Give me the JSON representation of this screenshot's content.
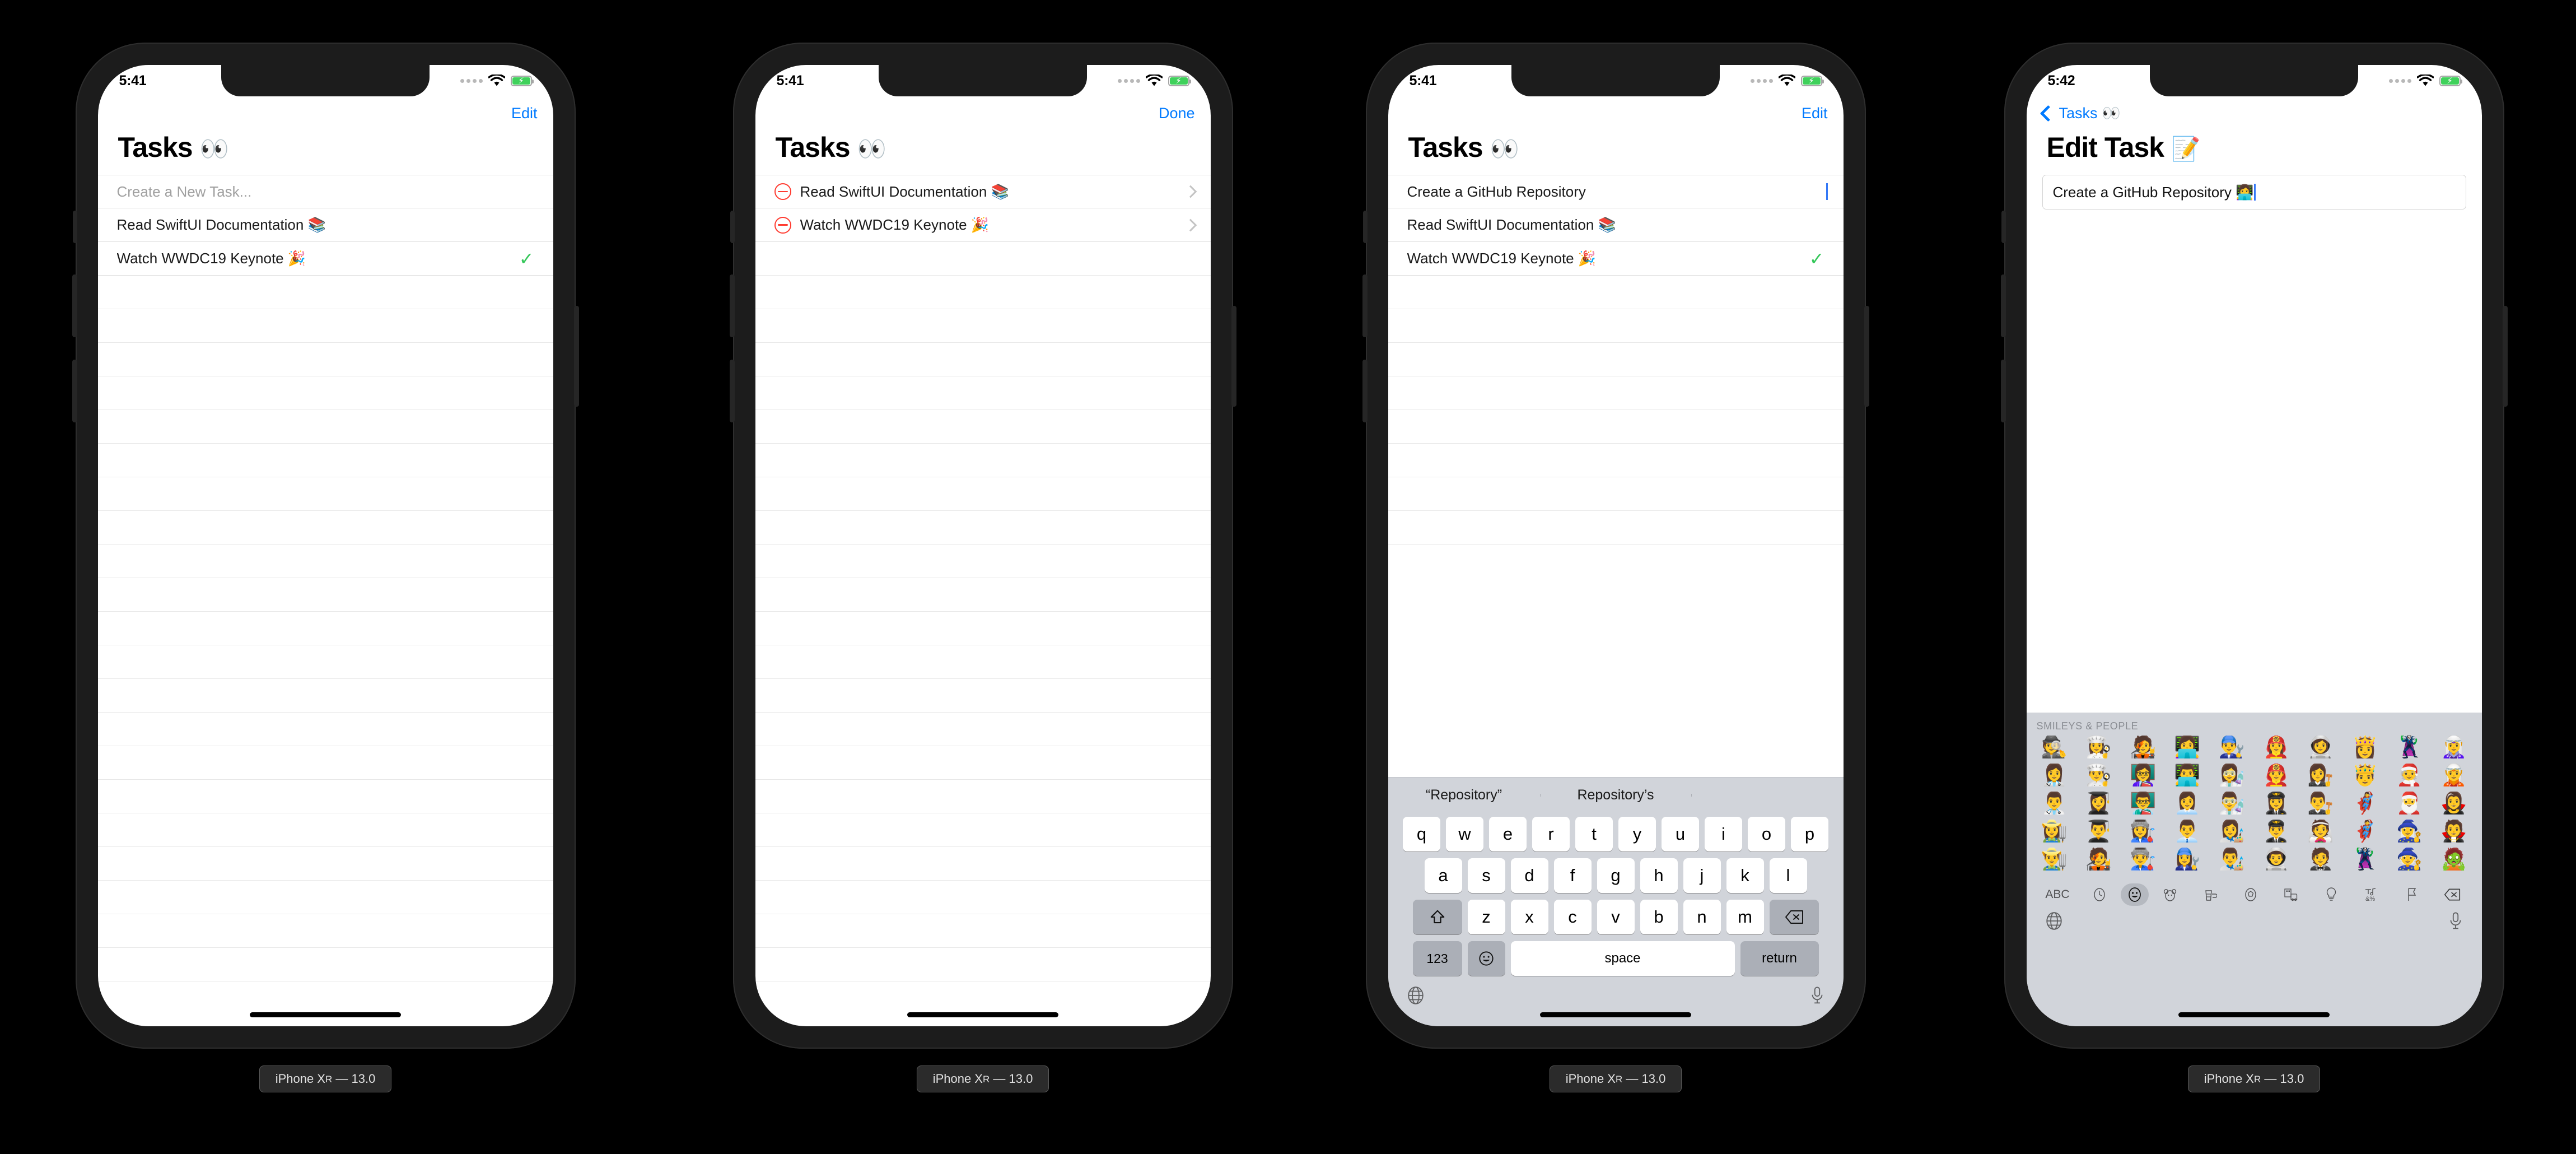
{
  "background_color": "#000000",
  "accent_color": "#007aff",
  "destructive_color": "#ff3b30",
  "success_color": "#34c759",
  "devices": [
    {
      "caption_prefix": "iPhone X",
      "caption_sub": "R",
      "caption_suffix": " — 13.0",
      "status_bar": {
        "time": "5:41",
        "wifi": "wifi-icon",
        "battery": "battery-charging-icon"
      },
      "nav": {
        "action_label": "Edit"
      },
      "title": {
        "text": "Tasks",
        "emoji": "👀"
      },
      "rows": [
        {
          "type": "input",
          "placeholder": "Create a New Task...",
          "value": "",
          "done": false
        },
        {
          "type": "task",
          "label": "Read SwiftUI Documentation 📚",
          "done": false
        },
        {
          "type": "task",
          "label": "Watch WWDC19 Keynote 🎉",
          "done": true
        }
      ],
      "empty_row_count": 22,
      "keyboard": "none"
    },
    {
      "caption_prefix": "iPhone X",
      "caption_sub": "R",
      "caption_suffix": " — 13.0",
      "status_bar": {
        "time": "5:41",
        "wifi": "wifi-icon",
        "battery": "battery-charging-icon"
      },
      "nav": {
        "action_label": "Done"
      },
      "title": {
        "text": "Tasks",
        "emoji": "👀"
      },
      "rows": [
        {
          "type": "task-editing",
          "label": "Read SwiftUI Documentation 📚",
          "done": false
        },
        {
          "type": "task-editing",
          "label": "Watch WWDC19 Keynote 🎉",
          "done": false
        }
      ],
      "empty_row_count": 23,
      "keyboard": "none"
    },
    {
      "caption_prefix": "iPhone X",
      "caption_sub": "R",
      "caption_suffix": " — 13.0",
      "status_bar": {
        "time": "5:41",
        "wifi": "wifi-icon",
        "battery": "battery-charging-icon"
      },
      "nav": {
        "action_label": "Edit"
      },
      "title": {
        "text": "Tasks",
        "emoji": "👀"
      },
      "rows": [
        {
          "type": "input",
          "placeholder": "Create a New Task...",
          "value": "Create a GitHub Repository",
          "done": false
        },
        {
          "type": "task",
          "label": "Read SwiftUI Documentation 📚",
          "done": false
        },
        {
          "type": "task",
          "label": "Watch WWDC19 Keynote 🎉",
          "done": true
        }
      ],
      "empty_row_count": 8,
      "keyboard": "qwerty"
    },
    {
      "caption_prefix": "iPhone X",
      "caption_sub": "R",
      "caption_suffix": " — 13.0",
      "status_bar": {
        "time": "5:42",
        "wifi": "wifi-icon",
        "battery": "battery-charging-icon"
      },
      "nav": {
        "back_label": "Tasks 👀"
      },
      "title": {
        "text": "Edit Task",
        "emoji": "📝"
      },
      "text_field": {
        "value": "Create a GitHub Repository 👩‍💻"
      },
      "keyboard": "emoji"
    }
  ],
  "qwerty_keyboard": {
    "suggestions": [
      "“Repository”",
      "Repository’s",
      ""
    ],
    "row1": [
      "q",
      "w",
      "e",
      "r",
      "t",
      "y",
      "u",
      "i",
      "o",
      "p"
    ],
    "row2": [
      "a",
      "s",
      "d",
      "f",
      "g",
      "h",
      "j",
      "k",
      "l"
    ],
    "row3": [
      "z",
      "x",
      "c",
      "v",
      "b",
      "n",
      "m"
    ],
    "shift_icon": "shift-icon",
    "backspace_icon": "backspace-icon",
    "numbers_label": "123",
    "emoji_key_icon": "emoji-smiley-icon",
    "space_label": "space",
    "return_label": "return",
    "globe_icon": "globe-icon",
    "mic_icon": "microphone-icon"
  },
  "emoji_keyboard": {
    "section_title": "SMILEYS & PEOPLE",
    "emojis": [
      "🕵️",
      "👩‍🍳",
      "🧑‍🎤",
      "👩‍💻",
      "👨‍🔧",
      "👩‍🚒",
      "👩‍🚀",
      "👸",
      "🦹",
      "🧝‍♀️",
      "👩‍⚕️",
      "👨‍🍳",
      "👩‍🏫",
      "👨‍💻",
      "👩‍🔬",
      "👨‍🚒",
      "👩‍⚖️",
      "🤴",
      "🧑‍🎄",
      "🧝",
      "👨‍⚕️",
      "👩‍🎓",
      "👨‍🏫",
      "👩‍💼",
      "👨‍🔬",
      "👩‍✈️",
      "👨‍⚖️",
      "🦸‍♀️",
      "🎅",
      "🧛‍♀️",
      "👩‍🌾",
      "👨‍🎓",
      "👩‍🏭",
      "👨‍💼",
      "👩‍🎨",
      "👨‍✈️",
      "👰",
      "🦸",
      "🧙‍♀️",
      "🧛",
      "👨‍🌾",
      "🧑‍🎤",
      "👨‍🏭",
      "👩‍🔧",
      "👨‍🎨",
      "👨‍🚀",
      "🤵",
      "🦹‍♀️",
      "🧙",
      "🧟"
    ],
    "categories": [
      {
        "name": "abc-button",
        "label": "ABC",
        "active": false
      },
      {
        "name": "recent-emoji-icon",
        "label": "🕐",
        "active": false
      },
      {
        "name": "smileys-people-icon",
        "label": "☺",
        "active": true
      },
      {
        "name": "animals-nature-icon",
        "label": "🐻",
        "active": false
      },
      {
        "name": "food-drink-icon",
        "label": "🍔",
        "active": false
      },
      {
        "name": "activity-icon",
        "label": "⚽",
        "active": false
      },
      {
        "name": "travel-places-icon",
        "label": "🚗",
        "active": false
      },
      {
        "name": "objects-icon",
        "label": "💡",
        "active": false
      },
      {
        "name": "symbols-icon",
        "label": "&%",
        "active": false
      },
      {
        "name": "flags-icon",
        "label": "⚑",
        "active": false
      },
      {
        "name": "backspace-icon",
        "label": "⌫",
        "active": false
      }
    ],
    "globe_icon": "globe-icon",
    "mic_icon": "microphone-icon"
  }
}
